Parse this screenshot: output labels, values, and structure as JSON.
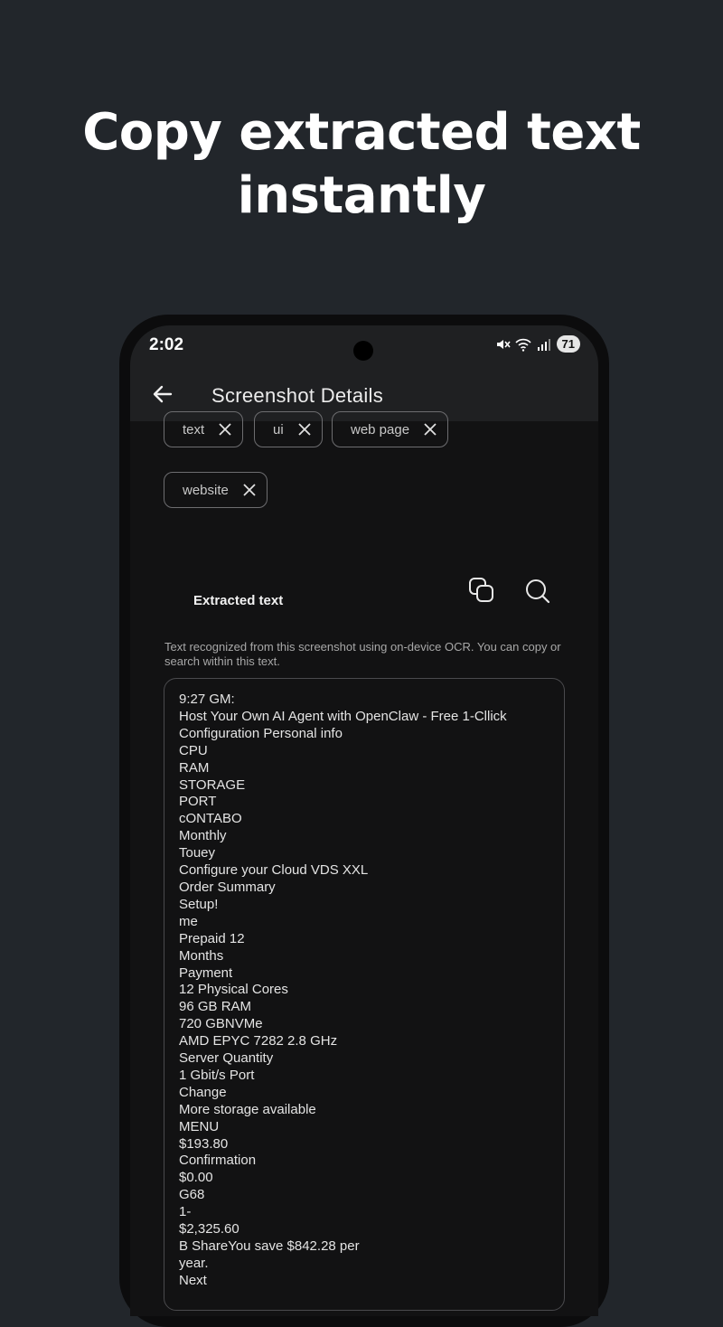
{
  "headline": {
    "line1": "Copy extracted text",
    "line2": "instantly"
  },
  "status_bar": {
    "time": "2:02",
    "battery": "71",
    "icons": [
      "mute-icon",
      "wifi-icon",
      "signal-icon"
    ]
  },
  "app_bar": {
    "title": "Screenshot Details",
    "back_icon": "arrow-left-icon"
  },
  "tags": [
    "text",
    "ui",
    "web page",
    "website"
  ],
  "extracted": {
    "title": "Extracted text",
    "copy_icon": "copy-icon",
    "search_icon": "search-icon",
    "description": "Text recognized from this screenshot using on-device OCR. You can copy or search within this text.",
    "lines": [
      "9:27 GM:",
      "Host Your Own AI Agent with OpenClaw - Free 1-Cllick",
      "Configuration Personal info",
      "CPU",
      "RAM",
      "STORAGE",
      "PORT",
      "cONTABO",
      "Monthly",
      "Touey",
      "Configure your Cloud VDS XXL",
      "Order Summary",
      "Setup!",
      "me",
      "Prepaid 12",
      "Months",
      "Payment",
      "12 Physical Cores",
      "96 GB RAM",
      "720 GBNVMe",
      "AMD EPYC 7282 2.8 GHz",
      "Server Quantity",
      "1 Gbit/s Port",
      "Change",
      "More storage available",
      "MENU",
      "$193.80",
      "Confirmation",
      "$0.00",
      "G68",
      "1-",
      "$2,325.60",
      "B ShareYou save $842.28 per",
      "year.",
      "Next"
    ]
  },
  "colors": {
    "background": "#22262b",
    "screen": "#121213",
    "app_bar": "#1f2022"
  }
}
